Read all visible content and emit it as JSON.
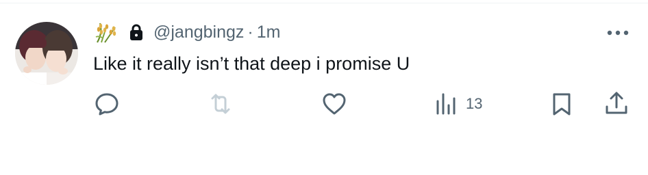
{
  "tweet": {
    "avatar_alt": "profile picture of two people",
    "display_name_icon": "rice-plant-emoji",
    "lock_icon": "lock-icon",
    "handle": "@jangbingz",
    "separator": "·",
    "time": "1m",
    "text": "Like it really isn’t that deep i promise U",
    "more_icon": "more-horizontal-icon"
  },
  "actions": {
    "reply_icon": "reply-icon",
    "retweet_icon": "retweet-icon",
    "retweet_disabled": true,
    "like_icon": "heart-icon",
    "views_icon": "views-icon",
    "views_count": "13",
    "bookmark_icon": "bookmark-icon",
    "share_icon": "share-icon"
  },
  "colors": {
    "text": "#0f1419",
    "secondary": "#536471",
    "disabled": "#c4cfd6",
    "divider": "#eff3f4",
    "background": "#ffffff"
  }
}
